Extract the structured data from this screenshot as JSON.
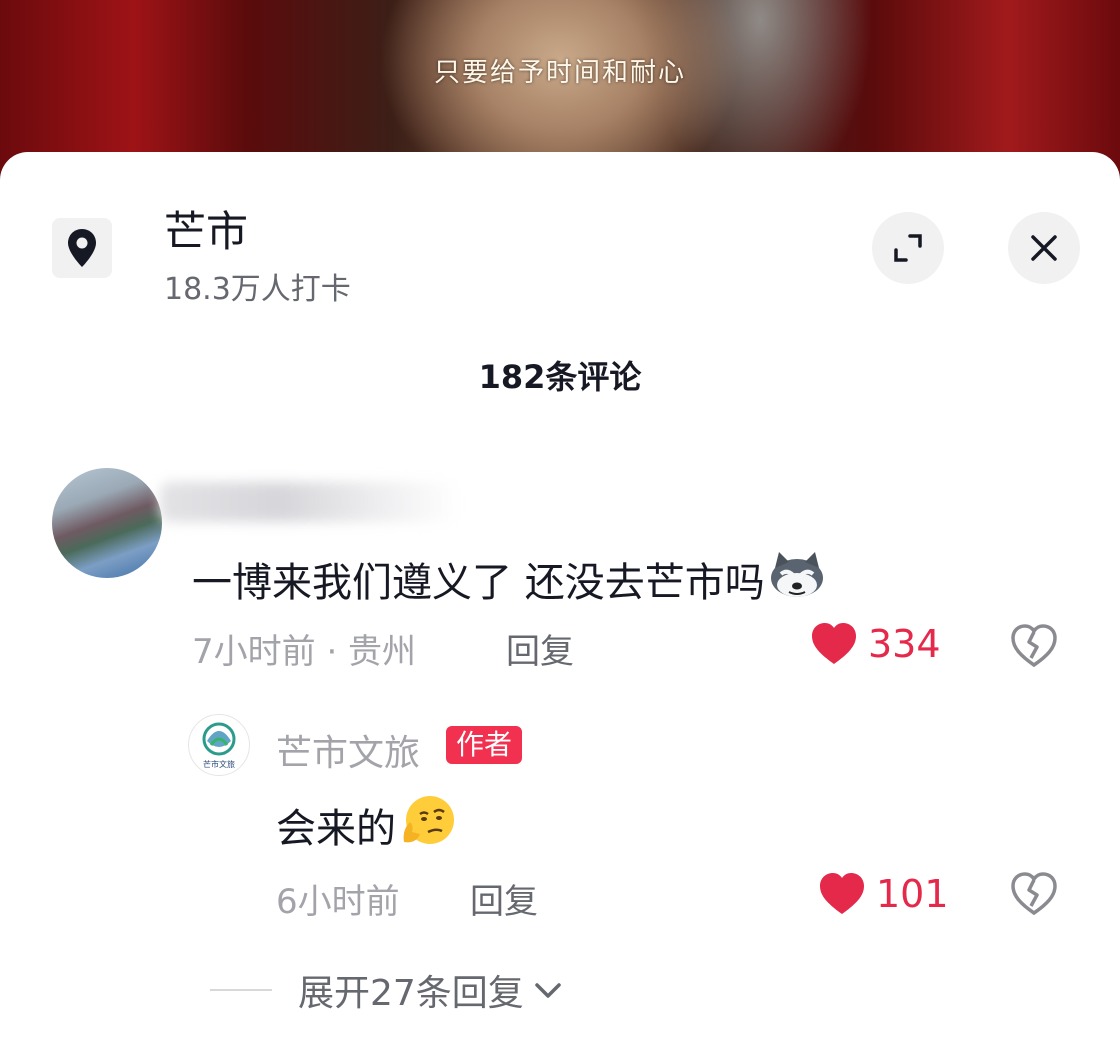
{
  "video": {
    "subtitle": "只要给予时间和耐心"
  },
  "location": {
    "name": "芒市",
    "checkins": "18.3万人打卡",
    "icon": "location-pin-icon"
  },
  "header_buttons": {
    "expand_icon": "expand-icon",
    "close_icon": "close-icon"
  },
  "comments_header": {
    "count_label": "182条评论"
  },
  "comment": {
    "text": "一博来我们遵义了 还没去芒市吗",
    "emoji": "husky-dog-emoji",
    "time_location": "7小时前 · 贵州",
    "reply_label": "回复",
    "likes": "334"
  },
  "reply": {
    "author": "芒市文旅",
    "badge": "作者",
    "text": "会来的",
    "emoji": "thinking-smirk-emoji",
    "time": "6小时前",
    "reply_label": "回复",
    "likes": "101",
    "avatar_text": "芒市文旅"
  },
  "expand_replies": {
    "label": "展开27条回复"
  },
  "colors": {
    "like_red": "#e4294b",
    "badge_red": "#f2304f",
    "text_dark": "#161823",
    "text_gray": "#a3a4aa"
  }
}
